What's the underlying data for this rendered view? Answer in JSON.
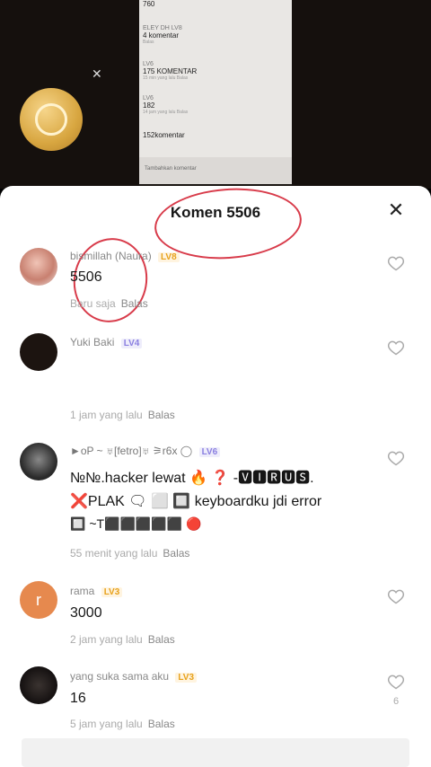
{
  "inner_screenshot": {
    "top_label": "760",
    "rows": [
      {
        "name": "ELEY DH LV8",
        "text": "4 komentar",
        "meta": "Balas"
      },
      {
        "name": "LV6",
        "text": "175 KOMENTAR",
        "meta": "15 min yang lalu  Balas"
      },
      {
        "name": "LV6",
        "text": "182",
        "meta": "14 jam yang lalu  Balas"
      },
      {
        "name": "",
        "text": "152komentar",
        "meta": ""
      }
    ],
    "bottom_text": "Tambahkan komentar"
  },
  "sheet": {
    "title": "Komen 5506",
    "close_icon": "close-icon"
  },
  "comments": [
    {
      "user": "bismillah (Naura)",
      "level": "LV8",
      "level_color": "#e7a11b",
      "text": "5506",
      "time": "Baru saja",
      "reply": "Balas",
      "likes": ""
    },
    {
      "user": "Yuki Baki",
      "level": "LV4",
      "level_color": "#8a7fe0",
      "text": "",
      "time": "1 jam yang lalu",
      "reply": "Balas",
      "likes": ""
    },
    {
      "user": "►oP ~ ♅[fetro]♅ ⚞r6x ◯",
      "level": "LV6",
      "level_color": "#8a7fe0",
      "text": "№№.hacker lewat 🔥 ❓ -🆅🅸🆁🆄🆂.",
      "text2": "❌PLAK 🗨 ⬜ 🔲 keyboardku jdi error",
      "text3": "🔲 ~T⬛⬛⬛⬛⬛ 🔴",
      "time": "55 menit yang lalu",
      "reply": "Balas",
      "likes": ""
    },
    {
      "user": "rama",
      "level": "LV3",
      "level_color": "#e7a11b",
      "avatar_letter": "r",
      "text": "3000",
      "time": "2 jam yang lalu",
      "reply": "Balas",
      "likes": ""
    },
    {
      "user": "yang suka sama aku",
      "level": "LV3",
      "level_color": "#e7a11b",
      "text": "16",
      "time": "5 jam yang lalu",
      "reply": "Balas",
      "likes": "6"
    }
  ]
}
